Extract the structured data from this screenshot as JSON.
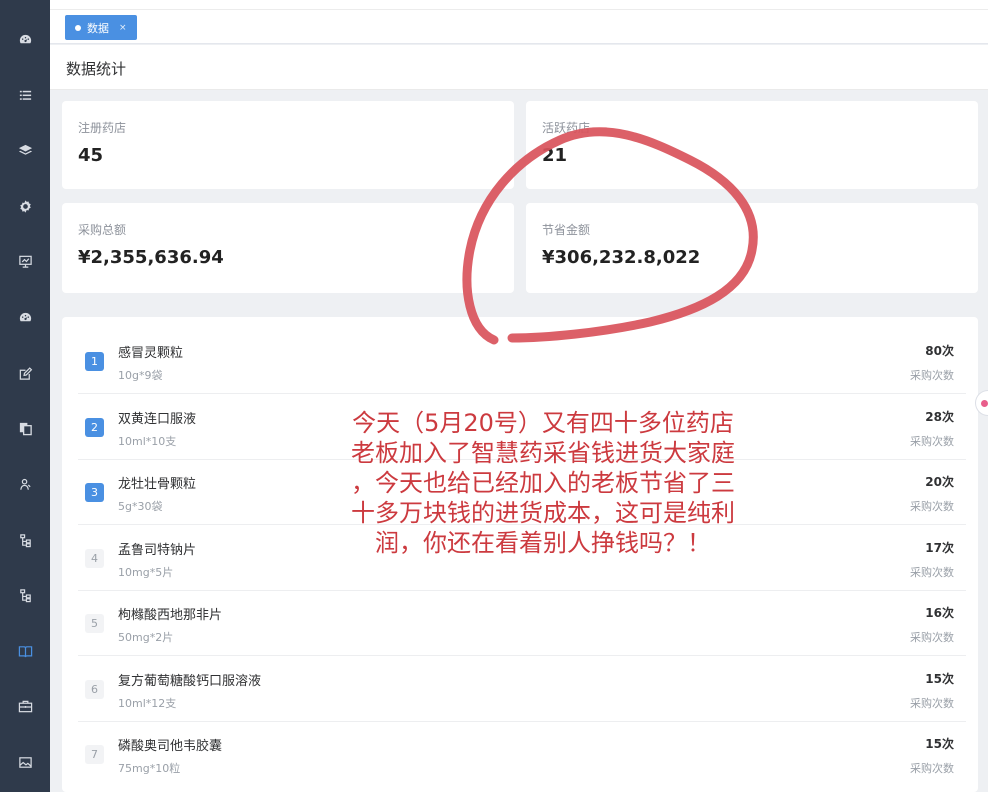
{
  "tab": {
    "label": "数据",
    "close": "×"
  },
  "page": {
    "title": "数据统计"
  },
  "stats": [
    {
      "label": "注册药店",
      "value": "45"
    },
    {
      "label": "活跃药店",
      "value": "21"
    },
    {
      "label": "采购总额",
      "value": "¥2,355,636.94"
    },
    {
      "label": "节省金额",
      "value": "¥306,232.8,022"
    }
  ],
  "ranking": [
    {
      "rank": "1",
      "name": "感冒灵颗粒",
      "spec": "10g*9袋",
      "count": "80次",
      "count_label": "采购次数"
    },
    {
      "rank": "2",
      "name": "双黄连口服液",
      "spec": "10ml*10支",
      "count": "28次",
      "count_label": "采购次数"
    },
    {
      "rank": "3",
      "name": "龙牡壮骨颗粒",
      "spec": "5g*30袋",
      "count": "20次",
      "count_label": "采购次数"
    },
    {
      "rank": "4",
      "name": "孟鲁司特钠片",
      "spec": "10mg*5片",
      "count": "17次",
      "count_label": "采购次数"
    },
    {
      "rank": "5",
      "name": "枸橼酸西地那非片",
      "spec": "50mg*2片",
      "count": "16次",
      "count_label": "采购次数"
    },
    {
      "rank": "6",
      "name": "复方葡萄糖酸钙口服溶液",
      "spec": "10ml*12支",
      "count": "15次",
      "count_label": "采购次数"
    },
    {
      "rank": "7",
      "name": "磷酸奥司他韦胶囊",
      "spec": "75mg*10粒",
      "count": "15次",
      "count_label": "采购次数"
    }
  ],
  "overlay": {
    "lines": [
      "今天（5月20号）又有四十多位药店",
      "老板加入了智慧药采省钱进货大家庭",
      "，今天也给已经加入的老板节省了三",
      "十多万块钱的进货成本，这可是纯利",
      "润，你还在看着别人挣钱吗？！"
    ],
    "color": "#cc3a3f"
  },
  "sidebar": {
    "icons": [
      "dashboard-icon",
      "list-icon",
      "layers-icon",
      "settings-icon",
      "monitor-icon",
      "dashboard-icon",
      "edit-icon",
      "copy-icon",
      "user-icon",
      "tree-icon",
      "tree-icon",
      "book-icon",
      "briefcase-icon",
      "image-icon"
    ],
    "active_index": 11,
    "background": "#2f3a4b",
    "accent": "#4a90e2"
  }
}
